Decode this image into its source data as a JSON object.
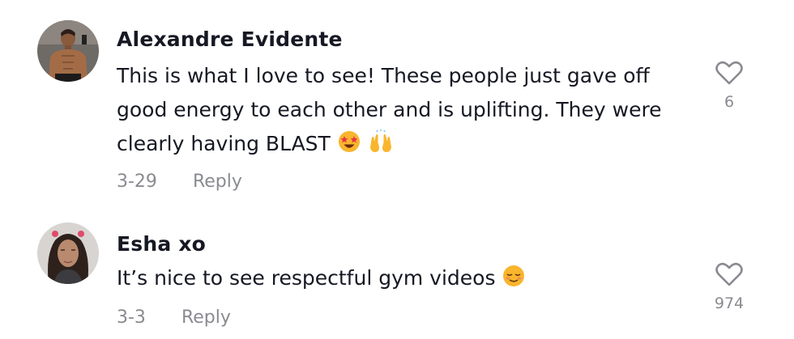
{
  "comments": [
    {
      "username": "Alexandre Evidente",
      "text": "This is what I love to see! These people just gave off good energy to each other and is uplifting. They were clearly having BLAST",
      "emojis": [
        "star-struck-emoji",
        "raising-hands-emoji"
      ],
      "date": "3-29",
      "reply_label": "Reply",
      "likes": "6"
    },
    {
      "username": "Esha xo",
      "text": "It’s nice to see respectful gym videos",
      "emojis": [
        "relieved-face-emoji"
      ],
      "date": "3-3",
      "reply_label": "Reply",
      "likes": "974"
    }
  ]
}
